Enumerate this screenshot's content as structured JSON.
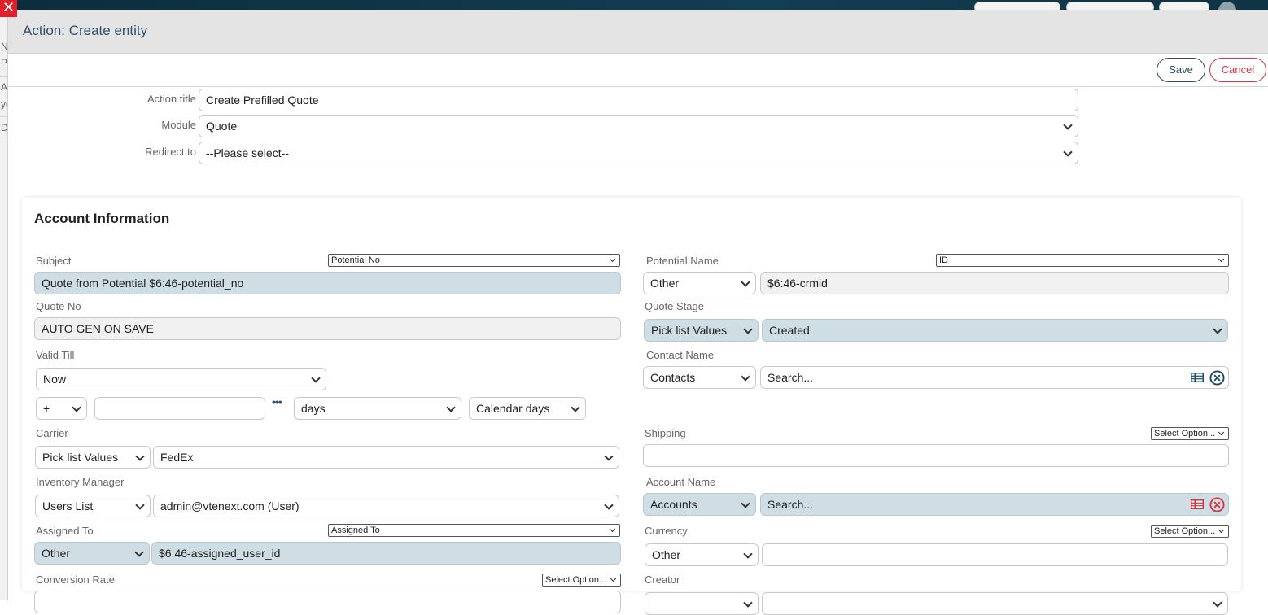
{
  "modal": {
    "title": "Action: Create entity",
    "save_label": "Save",
    "cancel_label": "Cancel"
  },
  "background": {
    "fragments": [
      "N",
      "Pr",
      "Ac",
      "ye",
      "D"
    ]
  },
  "top_fields": {
    "action_title": {
      "label": "Action title",
      "value": "Create Prefilled Quote"
    },
    "module": {
      "label": "Module",
      "value": "Quote"
    },
    "redirect": {
      "label": "Redirect to",
      "value": "--Please select--"
    }
  },
  "section": {
    "title": "Account Information",
    "left": {
      "subject": {
        "label": "Subject",
        "mini": "Potential No",
        "value": "Quote from Potential $6:46-potential_no"
      },
      "quote_no": {
        "label": "Quote No",
        "value": "AUTO GEN ON SAVE"
      },
      "valid_till": {
        "label": "Valid Till",
        "value": "Now",
        "sign": "+",
        "amount": "",
        "unit": "days",
        "calendar": "Calendar days"
      },
      "carrier": {
        "label": "Carrier",
        "type": "Pick list Values",
        "value": "FedEx"
      },
      "inventory_manager": {
        "label": "Inventory Manager",
        "type": "Users List",
        "value": "admin@vtenext.com (User)"
      },
      "assigned_to": {
        "label": "Assigned To",
        "mini": "Assigned To",
        "type": "Other",
        "value": "$6:46-assigned_user_id"
      },
      "conversion_rate": {
        "label": "Conversion Rate",
        "mini": "Select Option..."
      }
    },
    "right": {
      "potential_name": {
        "label": "Potential Name",
        "mini": "ID",
        "type": "Other",
        "value": "$6:46-crmid"
      },
      "quote_stage": {
        "label": "Quote Stage",
        "type": "Pick list Values",
        "value": "Created"
      },
      "contact_name": {
        "label": "Contact Name",
        "type": "Contacts",
        "placeholder": "Search..."
      },
      "shipping": {
        "label": "Shipping",
        "mini": "Select Option...",
        "value": ""
      },
      "account_name": {
        "label": "Account Name",
        "type": "Accounts",
        "placeholder": "Search..."
      },
      "currency": {
        "label": "Currency",
        "mini": "Select Option...",
        "type": "Other",
        "value": ""
      },
      "creator": {
        "label": "Creator"
      }
    }
  },
  "colors": {
    "accent": "#2c4d63",
    "danger": "#d9333f",
    "filled_field": "#cfdee4"
  }
}
